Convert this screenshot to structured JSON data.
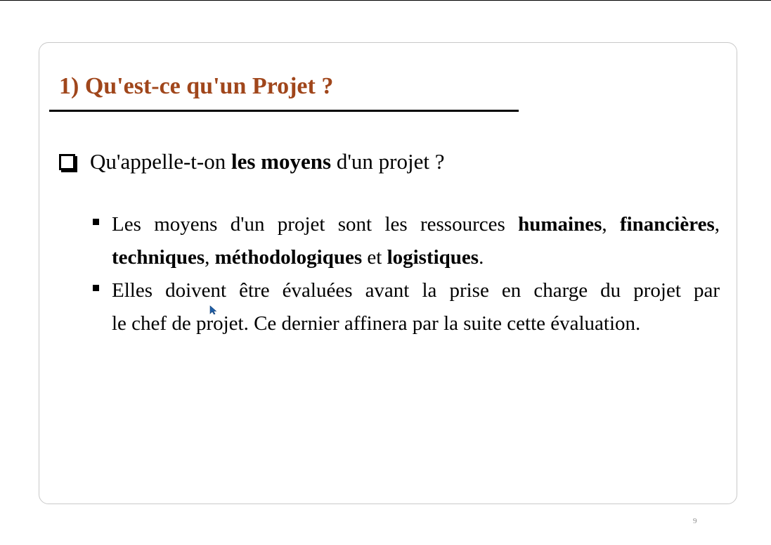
{
  "slide": {
    "title": "1) Qu'est-ce qu'un Projet ?",
    "question": {
      "before": "Qu'appelle-t-on ",
      "bold": "les moyens",
      "after": " d'un projet ?"
    },
    "bullet1": {
      "t1": "Les moyens d'un projet sont les ressources ",
      "b1": "humaines",
      "t2": ", ",
      "b2": "financières",
      "t3": ",",
      "b3": "techniques",
      "t4": ", ",
      "b4": "méthodologiques",
      "t5": " et ",
      "b5": "logistiques",
      "t6": "."
    },
    "bullet2": {
      "line1": "Elles doivent être évaluées avant la prise en charge du projet par",
      "line2": "le chef de projet. Ce dernier affinera par la suite cette évaluation."
    },
    "page_number": "9"
  },
  "colors": {
    "title": "#a0461b",
    "frame_border": "#c9c9c9",
    "cursor": "#1f5fa8"
  },
  "icons": {
    "question_marker": "hollow-square-checkbox-icon",
    "bullet_marker": "filled-square-bullet-icon",
    "cursor": "mouse-pointer-icon"
  }
}
